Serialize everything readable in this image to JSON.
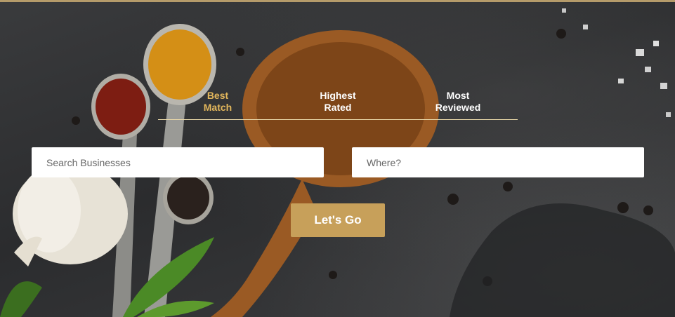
{
  "tabs": [
    {
      "line1": "Best",
      "line2": "Match",
      "active": true
    },
    {
      "line1": "Highest",
      "line2": "Rated",
      "active": false
    },
    {
      "line1": "Most",
      "line2": "Reviewed",
      "active": false
    }
  ],
  "search": {
    "business_placeholder": "Search Businesses",
    "where_placeholder": "Where?",
    "business_value": "",
    "where_value": ""
  },
  "cta": {
    "label": "Let's Go"
  },
  "colors": {
    "accent": "#c7a05a",
    "active_tab": "#e3b75c",
    "tab_underline": "#e8d7a8",
    "background": "#2f3032"
  }
}
